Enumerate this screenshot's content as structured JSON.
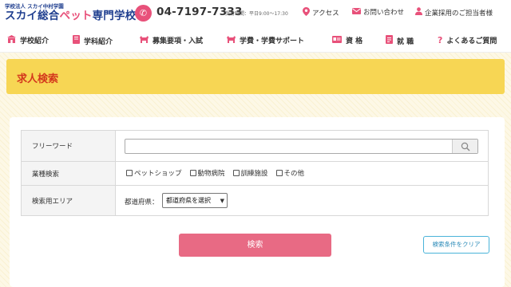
{
  "header": {
    "logo_sub": "学校法人 スカイ中村学園",
    "logo_main_a": "スカイ総合",
    "logo_main_b": "ペット",
    "logo_main_c": "専門学校",
    "phone": "04-7197-7333",
    "hours": "受付時間：平日9:00〜17:30",
    "links": [
      {
        "label": "アクセス",
        "icon": "map-pin-icon"
      },
      {
        "label": "お問い合わせ",
        "icon": "mail-icon"
      },
      {
        "label": "企業採用のご担当者様",
        "icon": "person-icon"
      }
    ]
  },
  "nav": {
    "items": [
      {
        "label": "学校紹介",
        "icon": "school-icon"
      },
      {
        "label": "学科紹介",
        "icon": "book-icon"
      },
      {
        "label": "募集要項・入試",
        "icon": "dog-icon"
      },
      {
        "label": "学費・学費サポート",
        "icon": "dog-icon"
      },
      {
        "label": "資 格",
        "icon": "card-icon"
      },
      {
        "label": "就 職",
        "icon": "document-icon"
      },
      {
        "label": "よくあるご質問",
        "icon": "question-icon"
      }
    ]
  },
  "page": {
    "title": "求人検索"
  },
  "form": {
    "free_word_label": "フリーワード",
    "free_word_value": "",
    "category_label": "業種検索",
    "categories": [
      "ペットショップ",
      "動物病院",
      "訓練施設",
      "その他"
    ],
    "area_label": "検索用エリア",
    "prefecture_label": "都道府県：",
    "prefecture_selected": "都道府県を選択",
    "search_button": "検索",
    "clear_button": "検索条件をクリア"
  },
  "colors": {
    "accent_pink": "#e8517a",
    "title_band": "#f7d654",
    "title_text": "#d4371c",
    "brand_blue": "#1f3e8f"
  }
}
